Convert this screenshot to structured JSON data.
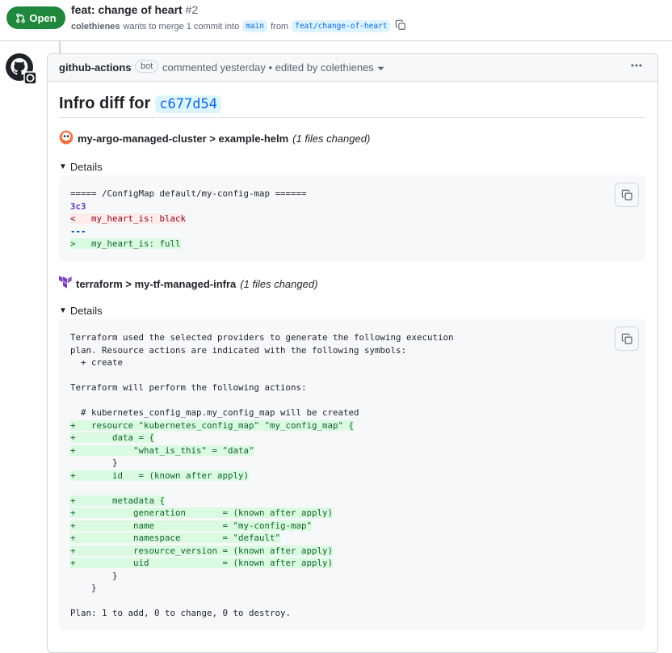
{
  "header": {
    "state": "Open",
    "title": "feat: change of heart",
    "number": "#2",
    "author": "colethienes",
    "merge_text": "wants to merge 1 commit into",
    "base_branch": "main",
    "from_text": "from",
    "head_branch": "feat/change-of-heart"
  },
  "comment": {
    "author": "github-actions",
    "bot_label": "bot",
    "meta": "commented yesterday • edited by colethienes",
    "title_prefix": "Infro diff for",
    "commit_sha": "c677d54"
  },
  "sections": [
    {
      "title": "my-argo-managed-cluster > example-helm",
      "changed": "(1 files changed)",
      "details_label": "Details",
      "lines": [
        {
          "text": "===== /ConfigMap default/my-config-map ======",
          "kind": "plain"
        },
        {
          "text": "3c3",
          "kind": "hunk"
        },
        {
          "text": "<   my_heart_is: black",
          "kind": "del"
        },
        {
          "text": "---",
          "kind": "sep"
        },
        {
          "text": ">   my_heart_is: full",
          "kind": "add"
        }
      ]
    },
    {
      "title": "terraform > my-tf-managed-infra",
      "changed": "(1 files changed)",
      "details_label": "Details",
      "lines": [
        {
          "text": "Terraform used the selected providers to generate the following execution",
          "kind": "plain"
        },
        {
          "text": "plan. Resource actions are indicated with the following symbols:",
          "kind": "plain"
        },
        {
          "text": "  + create",
          "kind": "plain"
        },
        {
          "text": "",
          "kind": "plain"
        },
        {
          "text": "Terraform will perform the following actions:",
          "kind": "plain"
        },
        {
          "text": "",
          "kind": "plain"
        },
        {
          "text": "  # kubernetes_config_map.my_config_map will be created",
          "kind": "plain"
        },
        {
          "text": "+   resource \"kubernetes_config_map\" \"my_config_map\" {",
          "kind": "add"
        },
        {
          "text": "+       data = {",
          "kind": "add"
        },
        {
          "text": "+           \"what_is_this\" = \"data\"",
          "kind": "add"
        },
        {
          "text": "        }",
          "kind": "plain"
        },
        {
          "text": "+       id   = (known after apply)",
          "kind": "add"
        },
        {
          "text": "",
          "kind": "plain"
        },
        {
          "text": "+       metadata {",
          "kind": "add"
        },
        {
          "text": "+           generation       = (known after apply)",
          "kind": "add"
        },
        {
          "text": "+           name             = \"my-config-map\"",
          "kind": "add"
        },
        {
          "text": "+           namespace        = \"default\"",
          "kind": "add"
        },
        {
          "text": "+           resource_version = (known after apply)",
          "kind": "add"
        },
        {
          "text": "+           uid              = (known after apply)",
          "kind": "add"
        },
        {
          "text": "        }",
          "kind": "plain"
        },
        {
          "text": "    }",
          "kind": "plain"
        },
        {
          "text": "",
          "kind": "plain"
        },
        {
          "text": "Plan: 1 to add, 0 to change, 0 to destroy.",
          "kind": "plain"
        }
      ]
    }
  ],
  "icons": {
    "state": "git-pull-request-icon",
    "copy": "copy-icon",
    "kebab": "kebab-horizontal-icon",
    "argo": "argo-icon",
    "terraform": "terraform-icon",
    "avatar": "github-mark-icon"
  }
}
